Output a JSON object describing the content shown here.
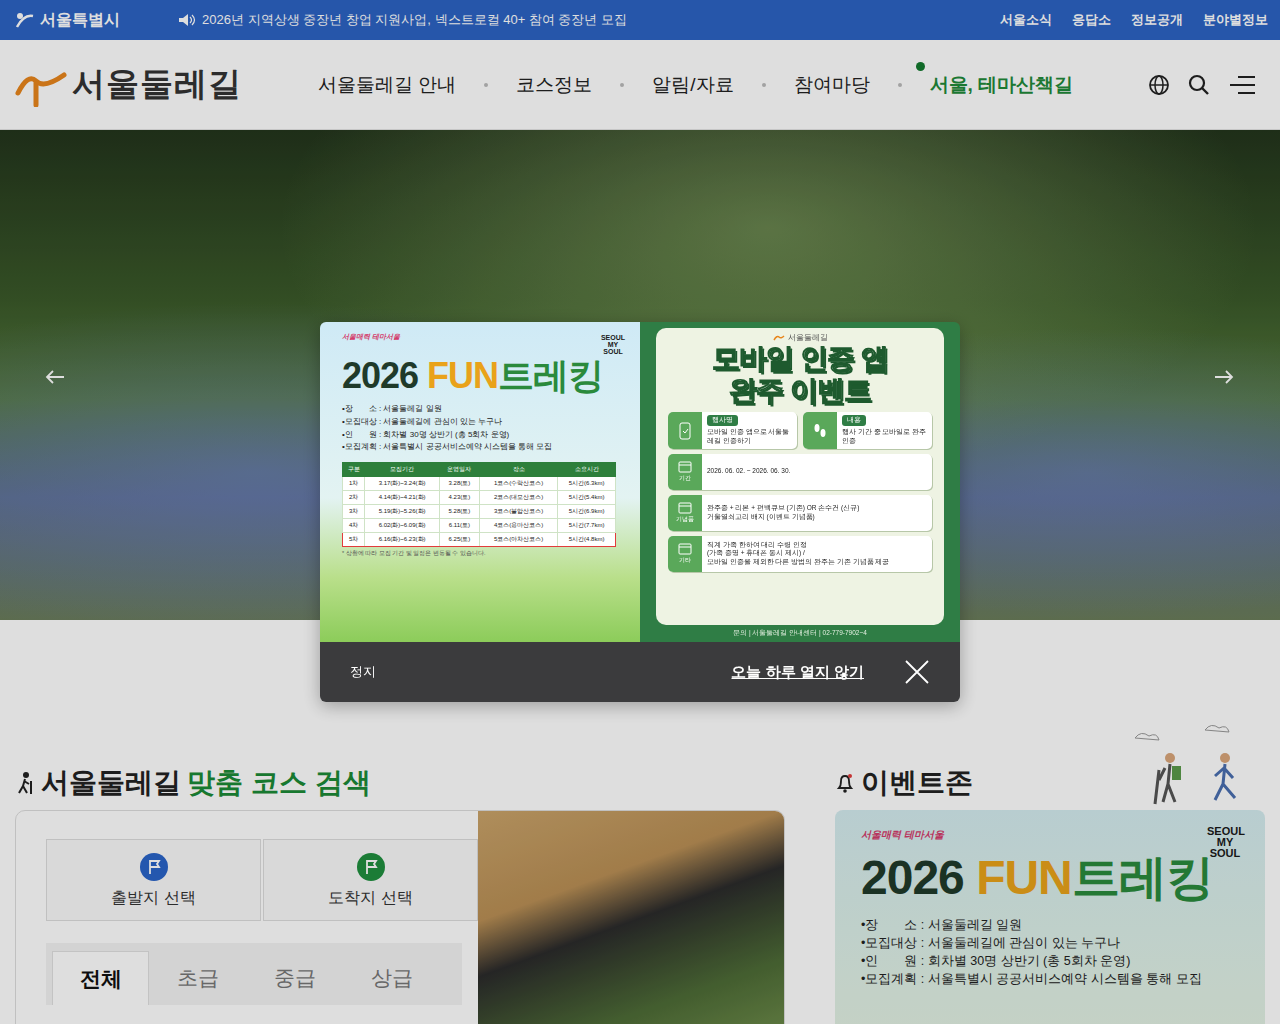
{
  "topbar": {
    "logo": "서울특별시",
    "notice": "2026년 지역상생 중장년 창업 지원사업, 넥스트로컬 40+ 참여 중장년 모집",
    "links": [
      "서울소식",
      "응답소",
      "정보공개",
      "분야별정보"
    ]
  },
  "header": {
    "logo": "서울둘레길",
    "nav": [
      {
        "label": "서울둘레길 안내",
        "kind": "normal"
      },
      {
        "label": "코스정보",
        "kind": "normal"
      },
      {
        "label": "알림/자료",
        "kind": "normal"
      },
      {
        "label": "참여마당",
        "kind": "normal"
      },
      {
        "label": "서울, 테마산책길",
        "kind": "theme"
      }
    ]
  },
  "course_search": {
    "title": "서울둘레길",
    "title_highlight": "맞춤 코스 검색",
    "start": "출발지 선택",
    "end": "도착지 선택",
    "tabs": [
      {
        "label": "전체",
        "selected": true
      },
      {
        "label": "초급",
        "selected": false
      },
      {
        "label": "중급",
        "selected": false
      },
      {
        "label": "상급",
        "selected": false
      }
    ]
  },
  "event_zone": {
    "title": "이벤트존",
    "brand": "서울매력 테마서울",
    "mark": "SEOUL MY SOUL",
    "poster_title": [
      {
        "text": "2026 ",
        "color": "#1f3a2a"
      },
      {
        "text": "FUN",
        "color": "#e9a21a"
      },
      {
        "text": "트레킹",
        "color": "#2a8a3c"
      }
    ],
    "lines": [
      "•장　　소 : 서울둘레길 일원",
      "•모집대상 : 서울둘레길에 관심이 있는 누구나",
      "•인　　원 : 회차별 30명 상반기 (총 5회차 운영)",
      "•모집계획 : 서울특별시 공공서비스예약 시스템을 통해 모집"
    ]
  },
  "popup": {
    "left": {
      "brand": "서울매력 테마서울",
      "mark": "SEOUL MY SOUL",
      "title": [
        {
          "text": "2026 ",
          "color": "#1f3a2a"
        },
        {
          "text": "FUN",
          "color": "#e9a21a"
        },
        {
          "text": "트레킹",
          "color": "#2a8a3c"
        }
      ],
      "lines": [
        "•장　　소 : 서울둘레길 일원",
        "•모집대상 : 서울둘레길에 관심이 있는 누구나",
        "•인　　원 : 회차별 30명 상반기 (총 5회차 운영)",
        "•모집계획 : 서울특별시 공공서비스예약 시스템을 통해 모집"
      ],
      "columns": [
        "구분",
        "모집기간",
        "운영일자",
        "장소",
        "소요시간"
      ],
      "rows": [
        {
          "cells": [
            "1차",
            "3.17(화)~3.24(화)",
            "3.28(토)",
            "1코스(수락산코스)",
            "5시간(6.3km)"
          ],
          "selected": false
        },
        {
          "cells": [
            "2차",
            "4.14(화)~4.21(화)",
            "4.23(토)",
            "2코스(대모산코스)",
            "5시간(5.4km)"
          ],
          "selected": false
        },
        {
          "cells": [
            "3차",
            "5.19(화)~5.26(화)",
            "5.28(토)",
            "3코스(불암산코스)",
            "5시간(6.9km)"
          ],
          "selected": false
        },
        {
          "cells": [
            "4차",
            "6.02(화)~6.09(화)",
            "6.11(토)",
            "4코스(용마산코스)",
            "5시간(7.7km)"
          ],
          "selected": false
        },
        {
          "cells": [
            "5차",
            "6.16(화)~6.23(화)",
            "6.25(토)",
            "5코스(아차산코스)",
            "5시간(4.8km)"
          ],
          "selected": true
        }
      ],
      "note": "* 상황에 따라 모집 기간 및 일정은 변동될 수 있습니다."
    },
    "right": {
      "logo": "서울둘레길",
      "title": [
        "모바일 인증 앱",
        "완주 이벤트"
      ],
      "event_label": "행사명",
      "event_text": "모바일 인증 앱으로 서울둘레길 인증하기",
      "content_label": "내용",
      "content_text": "행사 기간 중 모바일로 완주 인증",
      "rows": [
        {
          "icon_label": "기간",
          "lines": [
            "2026. 06. 02. ~ 2026. 06. 30."
          ]
        },
        {
          "icon_label": "기념품",
          "lines": [
            "완주증 + 리본 + 편백큐브 (기존) OR 손수건 (신규)",
            "거울열쇠고리 배지 (이벤트 기념품)"
          ]
        },
        {
          "icon_label": "기타",
          "lines": [
            "직계 가족 한하여 대리 수령 인정",
            "(가족 증명 + 휴대폰 동시 제시) /",
            "모바일 인증을 제외한 다른 방법의 완주는 기존 기념품 제공"
          ]
        }
      ],
      "contact": "문의 | 서울둘레길 안내센터 | 02-779-7902~4"
    },
    "stop": "정지",
    "dismiss": "오늘 하루 열지 않기"
  }
}
